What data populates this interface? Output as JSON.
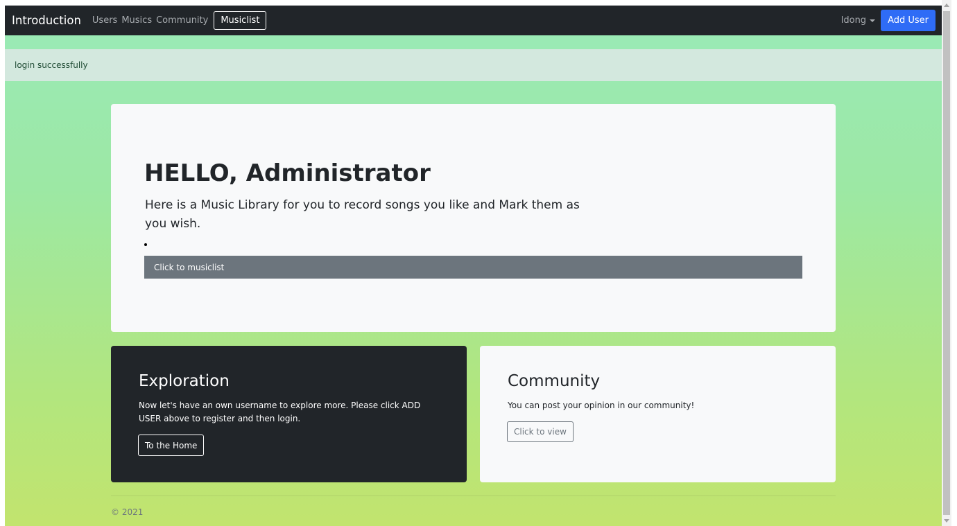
{
  "navbar": {
    "brand": "Introduction",
    "links": [
      "Users",
      "Musics",
      "Community"
    ],
    "active_link": "Musiclist",
    "user": "ldong",
    "add_user_label": "Add User"
  },
  "alert": {
    "message": "login successfully"
  },
  "jumbotron": {
    "title": "HELLO, Administrator",
    "lead": "Here is a Music Library for you to record songs you like and Mark them as you wish.",
    "button_label": "Click to musiclist"
  },
  "exploration_card": {
    "title": "Exploration",
    "text": "Now let's have an own username to explore more. Please click ADD USER above to register and then login.",
    "button_label": "To the Home"
  },
  "community_card": {
    "title": "Community",
    "text": "You can post your opinion in our community!",
    "button_label": "Click to view"
  },
  "footer": {
    "copyright": "© 2021"
  },
  "colors": {
    "navbar_bg": "#212529",
    "primary": "#2f6cf6",
    "secondary": "#6c757d",
    "alert_bg": "#d3e8de"
  }
}
